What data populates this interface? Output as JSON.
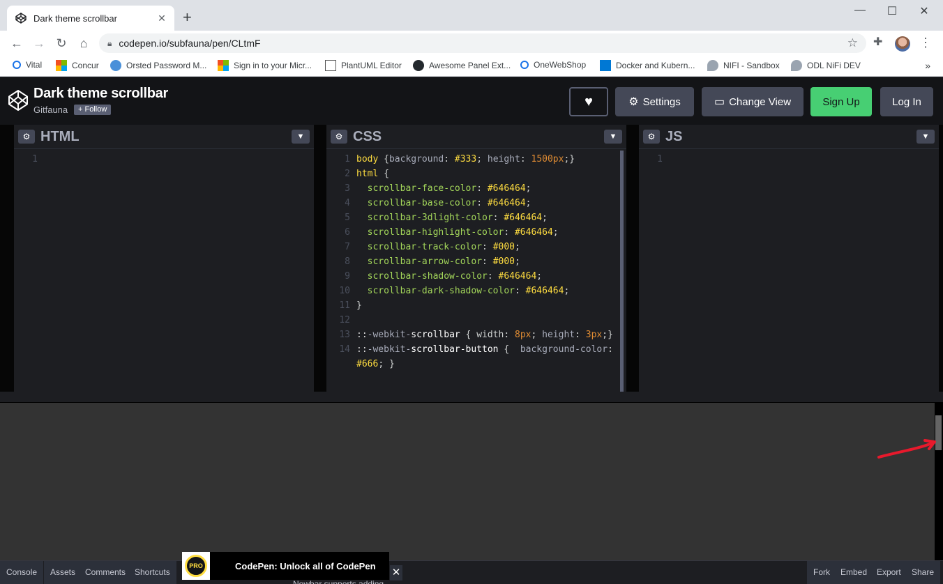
{
  "browser": {
    "tab_title": "Dark theme scrollbar",
    "url": "codepen.io/subfauna/pen/CLtmF",
    "bookmarks": [
      "Vital",
      "Concur",
      "Orsted Password M...",
      "Sign in to your Micr...",
      "PlantUML Editor",
      "Awesome Panel Ext...",
      "OneWebShop",
      "Docker and Kubern...",
      "NIFI - Sandbox",
      "ODL NiFi DEV"
    ]
  },
  "pen": {
    "title": "Dark theme scrollbar",
    "author": "Gitfauna",
    "follow_label": "+ Follow"
  },
  "header_buttons": {
    "settings": "Settings",
    "change_view": "Change View",
    "sign_up": "Sign Up",
    "log_in": "Log In"
  },
  "panes": {
    "html": "HTML",
    "css": "CSS",
    "js": "JS"
  },
  "css_lines": [
    "body {background: #333; height: 1500px;}",
    "html {",
    "  scrollbar-face-color: #646464;",
    "  scrollbar-base-color: #646464;",
    "  scrollbar-3dlight-color: #646464;",
    "  scrollbar-highlight-color: #646464;",
    "  scrollbar-track-color: #000;",
    "  scrollbar-arrow-color: #000;",
    "  scrollbar-shadow-color: #646464;",
    "  scrollbar-dark-shadow-color: #646464;",
    "}",
    "",
    "::-webkit-scrollbar { width: 8px; height: 3px;}",
    "::-webkit-scrollbar-button {  background-color: #666; }"
  ],
  "footer": {
    "left": [
      "Console",
      "Assets",
      "Comments",
      "Shortcuts"
    ],
    "right": [
      "Fork",
      "Embed",
      "Export",
      "Share"
    ],
    "promo": "CodePen: Unlock all of CodePen",
    "pro_badge": "PRO",
    "peek_text": "Nowbar supports adding"
  },
  "colors": {
    "editor_bg": "#1d1e22",
    "preview_bg": "#333333",
    "signup_green": "#47cf73",
    "scroll_thumb": "#646464",
    "annotation_arrow": "#e8192c"
  }
}
